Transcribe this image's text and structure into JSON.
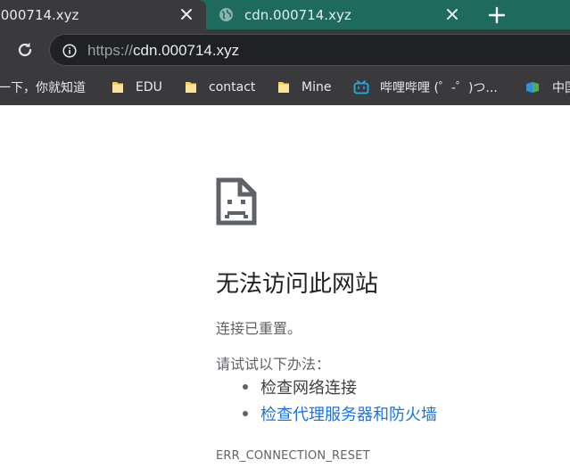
{
  "colors": {
    "tabstrip": "#1e6b5e",
    "toolbar": "#3a3a3c",
    "omnibox": "#202124",
    "link": "#1a73e8",
    "text_dark": "#202124",
    "text_muted": "#5f6368"
  },
  "tabs": [
    {
      "title": ".000714.xyz",
      "active": true,
      "favicon": "none"
    },
    {
      "title": "cdn.000714.xyz",
      "active": false,
      "favicon": "globe-icon"
    }
  ],
  "toolbar": {
    "url_scheme": "https://",
    "url_host": "cdn.000714.xyz"
  },
  "bookmarks": [
    {
      "label": "一下，你就知道",
      "icon": "none"
    },
    {
      "label": "EDU",
      "icon": "folder-icon"
    },
    {
      "label": "contact",
      "icon": "folder-icon"
    },
    {
      "label": "Mine",
      "icon": "folder-icon"
    },
    {
      "label": "哔哩哔哩 (゜-゜)つ...",
      "icon": "bilibili-icon"
    },
    {
      "label": "中国",
      "icon": "site-icon"
    }
  ],
  "error_page": {
    "title": "无法访问此网站",
    "description": "连接已重置。",
    "try_heading": "请试试以下办法：",
    "suggestions": [
      {
        "text": "检查网络连接",
        "link": false
      },
      {
        "text": "检查代理服务器和防火墙",
        "link": true
      }
    ],
    "error_code": "ERR_CONNECTION_RESET"
  }
}
